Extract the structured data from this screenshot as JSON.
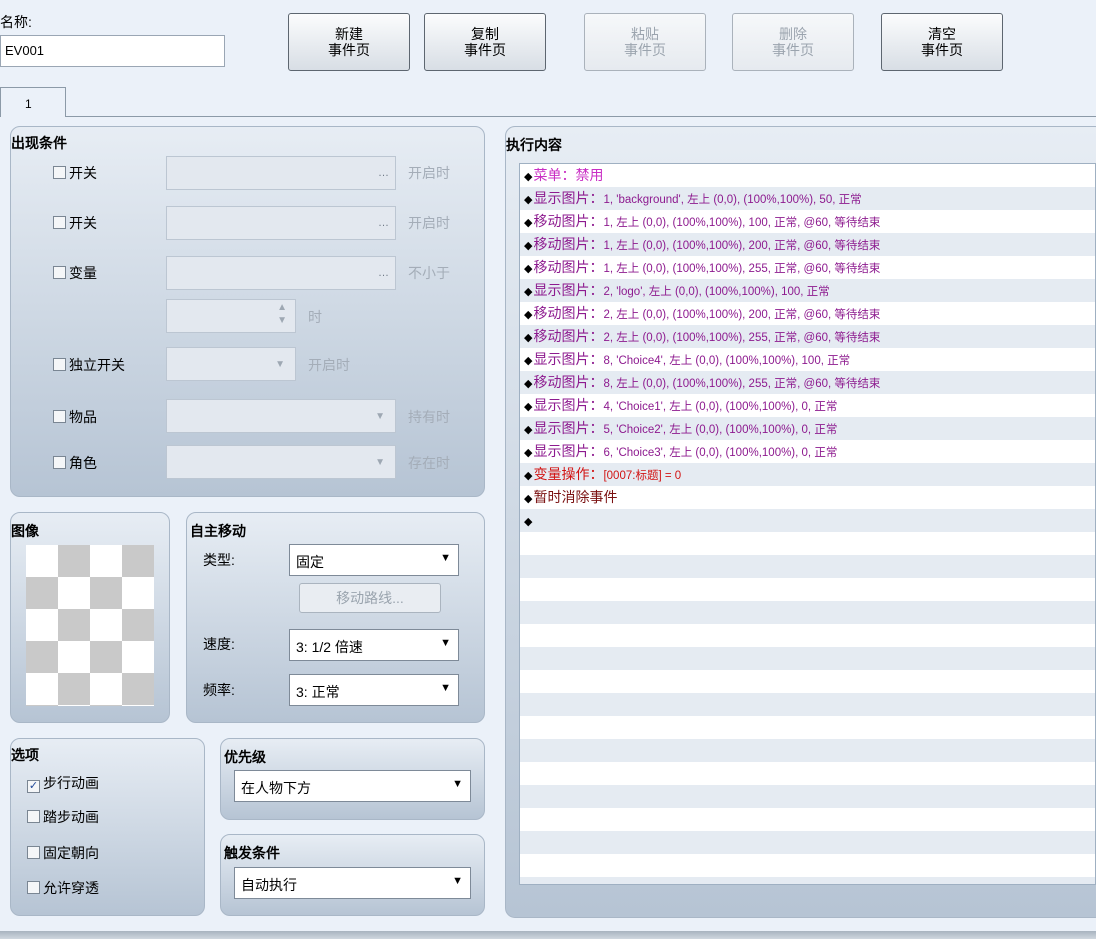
{
  "name_label": "名称:",
  "name_value": "EV001",
  "toolbar": [
    {
      "line1": "新建",
      "line2": "事件页",
      "enabled": true
    },
    {
      "line1": "复制",
      "line2": "事件页",
      "enabled": true
    },
    {
      "line1": "粘贴",
      "line2": "事件页",
      "enabled": false
    },
    {
      "line1": "删除",
      "line2": "事件页",
      "enabled": false
    },
    {
      "line1": "清空",
      "line2": "事件页",
      "enabled": true
    }
  ],
  "tab_label": "1",
  "conditions": {
    "title": "出现条件",
    "switch1": {
      "label": "开关",
      "ellipsis": "…",
      "suffix": "开启时"
    },
    "switch2": {
      "label": "开关",
      "ellipsis": "…",
      "suffix": "开启时"
    },
    "variable": {
      "label": "变量",
      "ellipsis": "…",
      "suffix": "不小于",
      "spin_suffix": "时"
    },
    "self_switch": {
      "label": "独立开关",
      "suffix": "开启时"
    },
    "item": {
      "label": "物品",
      "suffix": "持有时"
    },
    "actor": {
      "label": "角色",
      "suffix": "存在时"
    }
  },
  "image_panel": {
    "title": "图像"
  },
  "autonomous": {
    "title": "自主移动",
    "type_label": "类型:",
    "type_value": "固定",
    "route_button": "移动路线...",
    "speed_label": "速度:",
    "speed_value": "3: 1/2 倍速",
    "freq_label": "频率:",
    "freq_value": "3: 正常"
  },
  "options": {
    "title": "选项",
    "items": [
      {
        "label": "步行动画",
        "checked": true
      },
      {
        "label": "踏步动画",
        "checked": false
      },
      {
        "label": "固定朝向",
        "checked": false
      },
      {
        "label": "允许穿透",
        "checked": false
      }
    ]
  },
  "priority": {
    "title": "优先级",
    "value": "在人物下方"
  },
  "trigger": {
    "title": "触发条件",
    "value": "自动执行"
  },
  "contents": {
    "title": "执行内容",
    "lines": [
      {
        "cmd": "菜单：禁用",
        "args": "",
        "color": "magenta"
      },
      {
        "cmd": "显示图片：",
        "args": "1, 'background', 左上 (0,0), (100%,100%), 50, 正常",
        "color": "purple"
      },
      {
        "cmd": "移动图片：",
        "args": "1, 左上 (0,0), (100%,100%), 100, 正常, @60, 等待结束",
        "color": "purple"
      },
      {
        "cmd": "移动图片：",
        "args": "1, 左上 (0,0), (100%,100%), 200, 正常, @60, 等待结束",
        "color": "purple"
      },
      {
        "cmd": "移动图片：",
        "args": "1, 左上 (0,0), (100%,100%), 255, 正常, @60, 等待结束",
        "color": "purple"
      },
      {
        "cmd": "显示图片：",
        "args": "2, 'logo', 左上 (0,0), (100%,100%), 100, 正常",
        "color": "purple"
      },
      {
        "cmd": "移动图片：",
        "args": "2, 左上 (0,0), (100%,100%), 200, 正常, @60, 等待结束",
        "color": "purple"
      },
      {
        "cmd": "移动图片：",
        "args": "2, 左上 (0,0), (100%,100%), 255, 正常, @60, 等待结束",
        "color": "purple"
      },
      {
        "cmd": "显示图片：",
        "args": "8, 'Choice4', 左上 (0,0), (100%,100%), 100, 正常",
        "color": "purple"
      },
      {
        "cmd": "移动图片：",
        "args": "8, 左上 (0,0), (100%,100%), 255, 正常, @60, 等待结束",
        "color": "purple"
      },
      {
        "cmd": "显示图片：",
        "args": "4, 'Choice1', 左上 (0,0), (100%,100%), 0, 正常",
        "color": "purple"
      },
      {
        "cmd": "显示图片：",
        "args": "5, 'Choice2', 左上 (0,0), (100%,100%), 0, 正常",
        "color": "purple"
      },
      {
        "cmd": "显示图片：",
        "args": "6, 'Choice3', 左上 (0,0), (100%,100%), 0, 正常",
        "color": "purple"
      },
      {
        "cmd": "变量操作：",
        "args": "[0007:标题] = 0",
        "color": "red"
      },
      {
        "cmd": "暂时消除事件",
        "args": "",
        "color": "dred"
      },
      {
        "cmd": "",
        "args": "",
        "color": "dred"
      }
    ]
  },
  "colors": {
    "purple": "#8d1a8f",
    "magenta": "#c92ec4",
    "red": "#d21414",
    "dark_red": "#7a1010",
    "panel": "#c3cfdc",
    "background": "#ebf1f9"
  }
}
